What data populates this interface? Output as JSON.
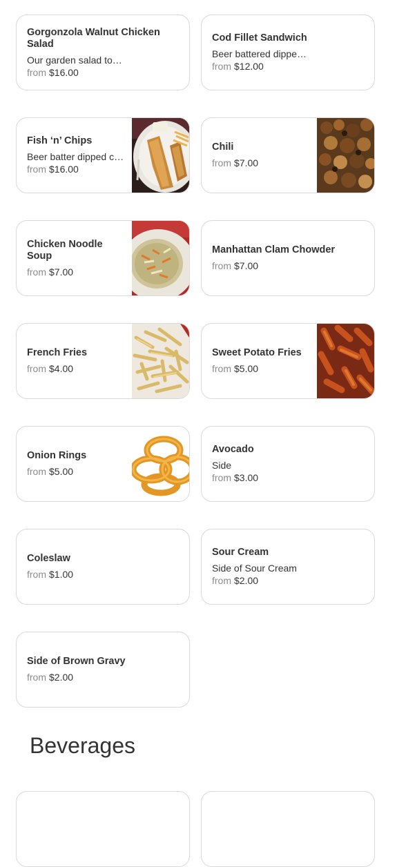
{
  "menu": {
    "items": [
      {
        "title": "Gorgonzola Walnut Chicken Salad",
        "desc": "Our garden salad to…",
        "from": "from",
        "price": "$16.00"
      },
      {
        "title": "Cod Fillet Sandwich",
        "desc": "Beer battered dippe…",
        "from": "from",
        "price": "$12.00"
      },
      {
        "title": "Fish ‘n’ Chips",
        "desc": "Beer batter dipped c…",
        "from": "from",
        "price": "$16.00",
        "image": "fish-and-chips"
      },
      {
        "title": "Chili",
        "from": "from",
        "price": "$7.00",
        "image": "chili"
      },
      {
        "title": "Chicken Noodle Soup",
        "from": "from",
        "price": "$7.00",
        "image": "chicken-noodle-soup"
      },
      {
        "title": "Manhattan Clam Chowder",
        "from": "from",
        "price": "$7.00"
      },
      {
        "title": "French Fries",
        "from": "from",
        "price": "$4.00",
        "image": "french-fries"
      },
      {
        "title": "Sweet Potato Fries",
        "from": "from",
        "price": "$5.00",
        "image": "sweet-potato-fries"
      },
      {
        "title": "Onion Rings",
        "from": "from",
        "price": "$5.00",
        "image": "onion-rings"
      },
      {
        "title": "Avocado",
        "desc": "Side",
        "from": "from",
        "price": "$3.00"
      },
      {
        "title": "Coleslaw",
        "from": "from",
        "price": "$1.00"
      },
      {
        "title": "Sour Cream",
        "desc": "Side of Sour Cream",
        "from": "from",
        "price": "$2.00"
      },
      {
        "title": "Side of Brown Gravy",
        "from": "from",
        "price": "$2.00"
      }
    ]
  },
  "sections": {
    "beverages": {
      "title": "Beverages"
    }
  }
}
